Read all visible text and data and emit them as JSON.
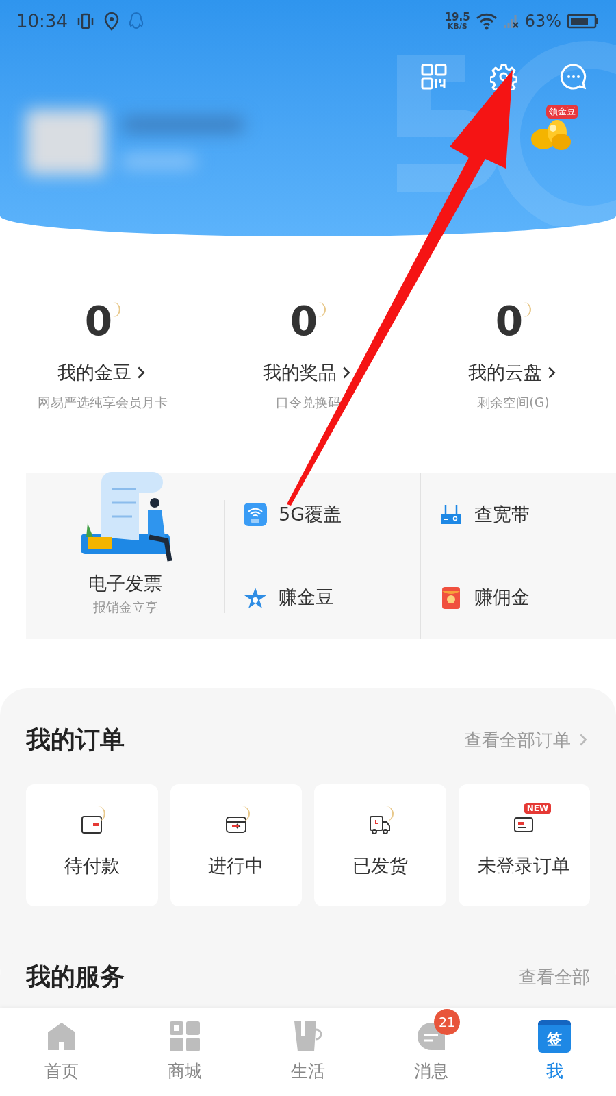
{
  "status_bar": {
    "time": "10:34",
    "speed_value": "19.5",
    "speed_unit": "KB/S",
    "battery": "63%"
  },
  "header": {
    "bean_badge": "领金豆"
  },
  "stats": [
    {
      "value": "0",
      "title": "我的金豆",
      "subtitle": "网易严选纯享会员月卡"
    },
    {
      "value": "0",
      "title": "我的奖品",
      "subtitle": "口令兑换码"
    },
    {
      "value": "0",
      "title": "我的云盘",
      "subtitle": "剩余空间(G)"
    }
  ],
  "services": {
    "feature": {
      "title": "电子发票",
      "subtitle": "报销金立享"
    },
    "items": [
      {
        "kind": "wifi",
        "label": "5G覆盖"
      },
      {
        "kind": "router",
        "label": "查宽带"
      },
      {
        "kind": "star",
        "label": "赚金豆"
      },
      {
        "kind": "redpacket",
        "label": "赚佣金"
      }
    ]
  },
  "orders": {
    "title": "我的订单",
    "link": "查看全部订单",
    "items": [
      {
        "kind": "wallet",
        "label": "待付款"
      },
      {
        "kind": "box",
        "label": "进行中"
      },
      {
        "kind": "truck",
        "label": "已发货"
      },
      {
        "kind": "card",
        "label": "未登录订单",
        "badge": "NEW"
      }
    ]
  },
  "my_services": {
    "title": "我的服务",
    "link": "查看全部"
  },
  "nav": [
    {
      "kind": "home",
      "label": "首页",
      "selected": false
    },
    {
      "kind": "grid",
      "label": "商城",
      "selected": false
    },
    {
      "kind": "cup",
      "label": "生活",
      "selected": false
    },
    {
      "kind": "chat",
      "label": "消息",
      "selected": false,
      "badge": "21"
    },
    {
      "kind": "calendar",
      "label": "我",
      "selected": true,
      "icon_text": "签"
    }
  ]
}
